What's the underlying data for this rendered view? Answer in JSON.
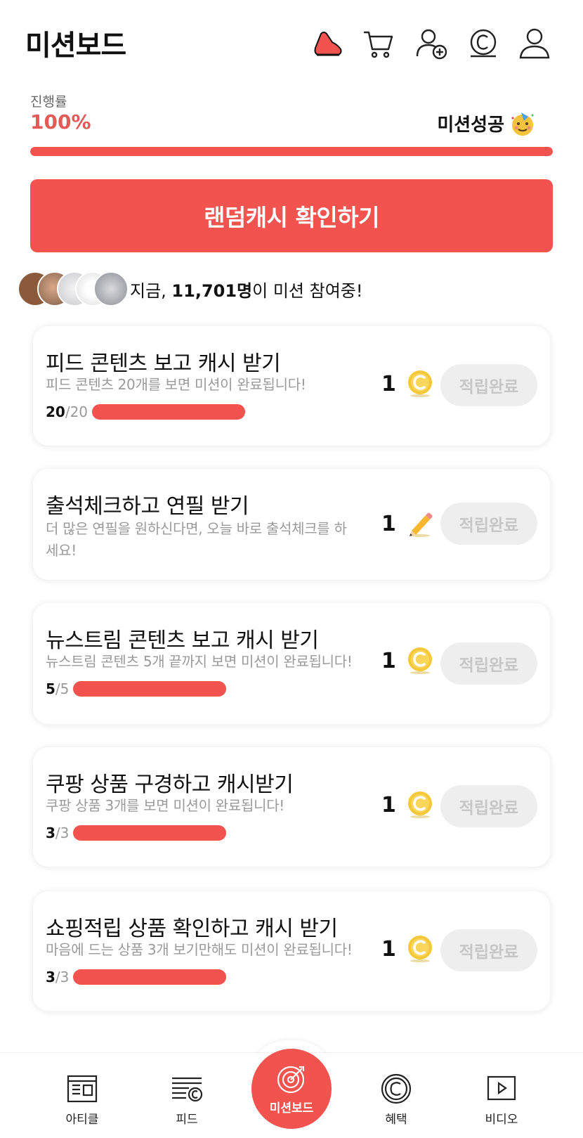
{
  "header": {
    "title": "미션보드",
    "icons": [
      "sneaker-icon",
      "cart-icon",
      "add-friend-icon",
      "cash-coin-icon",
      "profile-icon"
    ]
  },
  "progress": {
    "label": "진행률",
    "value": "100%",
    "fraction": 1.0,
    "status": "미션성공",
    "accent": "#f2534f"
  },
  "random_button": {
    "label": "랜덤캐시 확인하기"
  },
  "participants": {
    "prefix": "지금, ",
    "count": "11,701명",
    "suffix": "이 미션 참여중!"
  },
  "missions": [
    {
      "title": "피드 콘텐츠 보고 캐시 받기",
      "desc": "피드 콘텐츠 20개를 보면 미션이 완료됩니다!",
      "done": "20",
      "total": "/20",
      "fraction": 1.0,
      "reward": "1",
      "reward_type": "coin-icon",
      "button": "적립완료"
    },
    {
      "title": "출석체크하고 연필 받기",
      "desc": "더 많은 연필을 원하신다면, 오늘 바로 출석체크를 하세요!",
      "reward": "1",
      "reward_type": "pencil-icon",
      "button": "적립완료"
    },
    {
      "title": "뉴스트림 콘텐츠 보고 캐시 받기",
      "desc": "뉴스트림 콘텐츠 5개 끝까지 보면 미션이 완료됩니다!",
      "done": "5",
      "total": "/5",
      "fraction": 1.0,
      "reward": "1",
      "reward_type": "coin-icon",
      "button": "적립완료"
    },
    {
      "title": "쿠팡 상품 구경하고 캐시받기",
      "desc": "쿠팡 상품 3개를 보면 미션이 완료됩니다!",
      "done": "3",
      "total": "/3",
      "fraction": 1.0,
      "reward": "1",
      "reward_type": "coin-icon",
      "button": "적립완료"
    },
    {
      "title": "쇼핑적립 상품 확인하고 캐시 받기",
      "desc": "마음에 드는 상품 3개 보기만해도 미션이 완료됩니다!",
      "done": "3",
      "total": "/3",
      "fraction": 1.0,
      "reward": "1",
      "reward_type": "coin-icon",
      "button": "적립완료"
    }
  ],
  "bottom_nav": {
    "items": [
      {
        "label": "아티클",
        "icon": "article-icon"
      },
      {
        "label": "피드",
        "icon": "feed-icon"
      },
      {
        "label": "미션보드",
        "icon": "target-icon",
        "active": true
      },
      {
        "label": "혜택",
        "icon": "benefit-coin-icon"
      },
      {
        "label": "비디오",
        "icon": "video-icon"
      }
    ]
  }
}
